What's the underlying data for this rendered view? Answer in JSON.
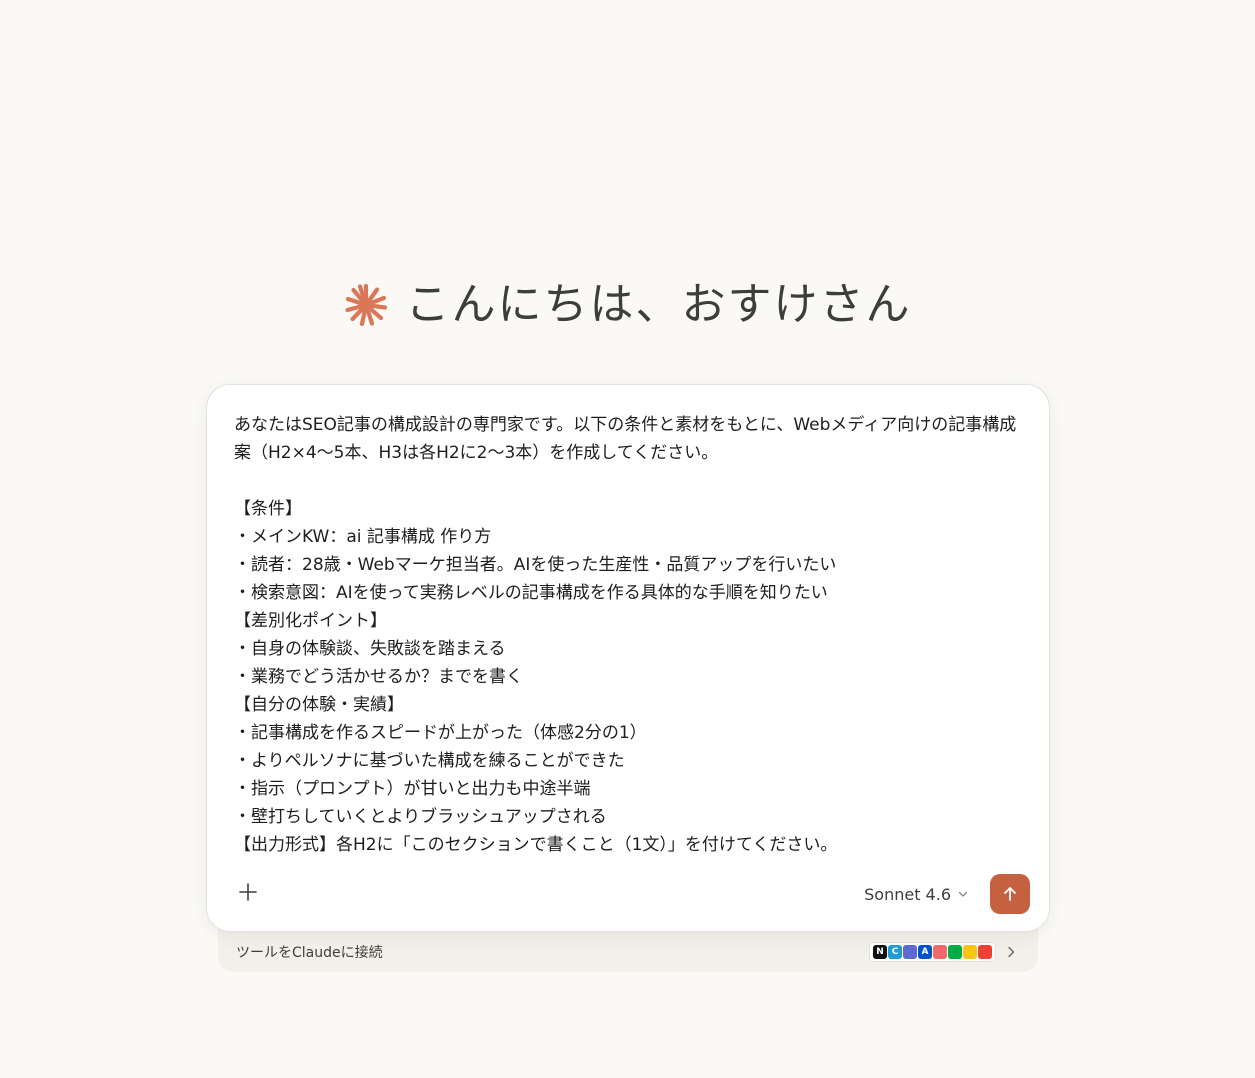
{
  "greeting": {
    "text": "こんにちは、おすけさん",
    "icon": "claude-spark-icon",
    "icon_color": "#d97757"
  },
  "composer": {
    "prompt": "あなたはSEO記事の構成設計の専門家です。以下の条件と素材をもとに、Webメディア向けの記事構成案（H2×4〜5本、H3は各H2に2〜3本）を作成してください。\n\n【条件】\n・メインKW：ai 記事構成 作り方\n・読者：28歳・Webマーケ担当者。AIを使った生産性・品質アップを行いたい\n・検索意図：AIを使って実務レベルの記事構成を作る具体的な手順を知りたい\n【差別化ポイント】\n・自身の体験談、失敗談を踏まえる\n・業務でどう活かせるか？までを書く\n【自分の体験・実績】\n・記事構成を作るスピードが上がった（体感2分の1）\n・よりペルソナに基づいた構成を練ることができた\n・指示（プロンプト）が甘いと出力も中途半端\n・壁打ちしていくとよりブラッシュアップされる\n【出力形式】各H2に「このセクションで書くこと（1文）」を付けてください。",
    "model_label": "Sonnet 4.6",
    "send_color": "#c6613f"
  },
  "tools": {
    "label": "ツールをClaudeに接続",
    "apps": [
      {
        "name": "notion-icon",
        "glyph": "N",
        "color": "#111111"
      },
      {
        "name": "canva-icon",
        "glyph": "C",
        "color": "#1e9cd7"
      },
      {
        "name": "linear-icon",
        "glyph": "",
        "color": "#5e6ad2"
      },
      {
        "name": "atlassian-icon",
        "glyph": "A",
        "color": "#0052cc"
      },
      {
        "name": "asana-icon",
        "glyph": "",
        "color": "#f06a6a"
      },
      {
        "name": "google-meet-icon",
        "glyph": "",
        "color": "#00ac47"
      },
      {
        "name": "notes-icon",
        "glyph": "",
        "color": "#f5c518"
      },
      {
        "name": "chrome-icon",
        "glyph": "",
        "color": "#ea4335"
      }
    ]
  }
}
